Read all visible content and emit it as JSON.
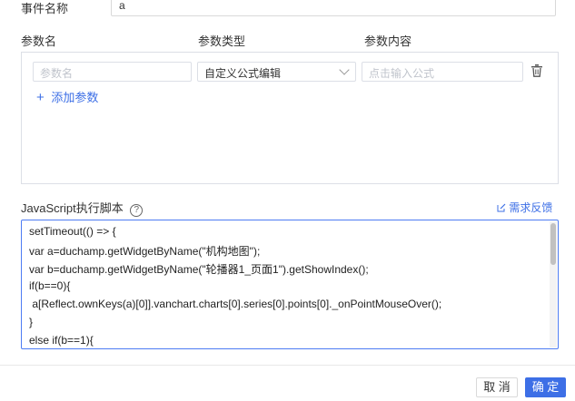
{
  "event": {
    "label": "事件名称",
    "value": "a"
  },
  "params": {
    "headers": {
      "name": "参数名",
      "type": "参数类型",
      "content": "参数内容"
    },
    "row": {
      "name_placeholder": "参数名",
      "type_value": "自定义公式编辑",
      "content_placeholder": "点击输入公式"
    },
    "add_label": "添加参数",
    "add_icon": "+"
  },
  "script": {
    "label": "JavaScript执行脚本",
    "help_icon": "?",
    "feedback_label": "需求反馈",
    "lines": [
      "setTimeout(() => {",
      "var a=duchamp.getWidgetByName(\"机构地图\");",
      "var b=duchamp.getWidgetByName(\"轮播器1_页面1\").getShowIndex();",
      "if(b==0){",
      " a[Reflect.ownKeys(a)[0]].vanchart.charts[0].series[0].points[0]._onPointMouseOver();",
      "}",
      "else if(b==1){"
    ]
  },
  "footer": {
    "cancel_label": "取 消",
    "ok_label": "确 定"
  },
  "colors": {
    "accent": "#3d6fe6"
  }
}
